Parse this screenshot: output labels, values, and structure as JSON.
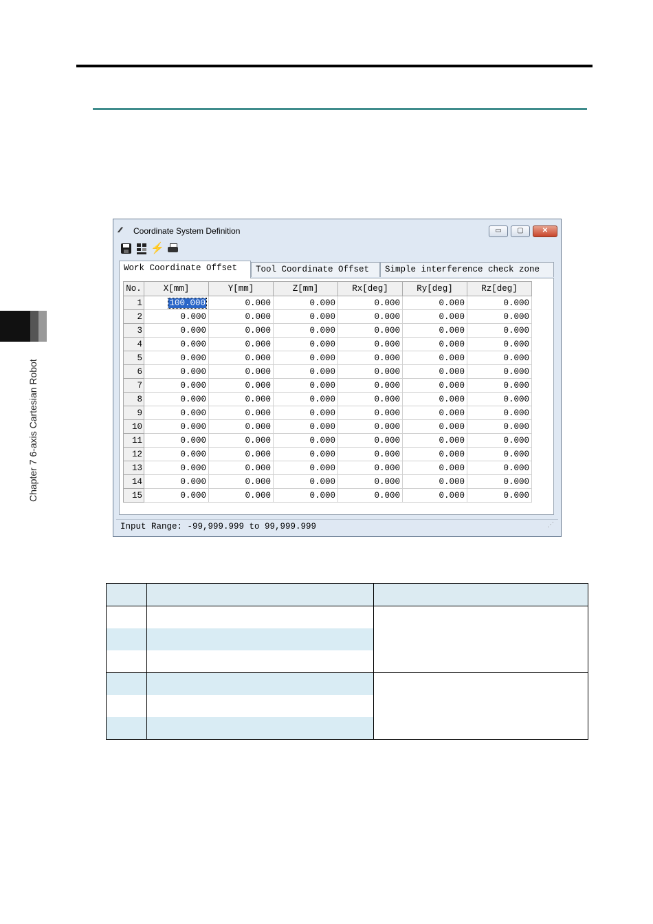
{
  "page": {
    "chapter_label": "Chapter 7 6-axis Cartesian Robot"
  },
  "window": {
    "title": "Coordinate System Definition",
    "app_icon_glyph": "⁄⁄⁄",
    "controls": {
      "minimize": "▭",
      "maximize": "▢",
      "close": "✕"
    }
  },
  "toolbar": {
    "icons": [
      "save-icon",
      "grid-export-icon",
      "lightning-icon",
      "print-icon"
    ]
  },
  "tabs": [
    {
      "label": "Work Coordinate Offset",
      "active": true
    },
    {
      "label": "Tool Coordinate Offset",
      "active": false
    },
    {
      "label": "Simple interference check zone",
      "active": false
    }
  ],
  "grid": {
    "headers": [
      "No.",
      "X[mm]",
      "Y[mm]",
      "Z[mm]",
      "Rx[deg]",
      "Ry[deg]",
      "Rz[deg]"
    ],
    "rows": [
      {
        "no": "1",
        "values": [
          "100.000",
          "0.000",
          "0.000",
          "0.000",
          "0.000",
          "0.000"
        ]
      },
      {
        "no": "2",
        "values": [
          "0.000",
          "0.000",
          "0.000",
          "0.000",
          "0.000",
          "0.000"
        ]
      },
      {
        "no": "3",
        "values": [
          "0.000",
          "0.000",
          "0.000",
          "0.000",
          "0.000",
          "0.000"
        ]
      },
      {
        "no": "4",
        "values": [
          "0.000",
          "0.000",
          "0.000",
          "0.000",
          "0.000",
          "0.000"
        ]
      },
      {
        "no": "5",
        "values": [
          "0.000",
          "0.000",
          "0.000",
          "0.000",
          "0.000",
          "0.000"
        ]
      },
      {
        "no": "6",
        "values": [
          "0.000",
          "0.000",
          "0.000",
          "0.000",
          "0.000",
          "0.000"
        ]
      },
      {
        "no": "7",
        "values": [
          "0.000",
          "0.000",
          "0.000",
          "0.000",
          "0.000",
          "0.000"
        ]
      },
      {
        "no": "8",
        "values": [
          "0.000",
          "0.000",
          "0.000",
          "0.000",
          "0.000",
          "0.000"
        ]
      },
      {
        "no": "9",
        "values": [
          "0.000",
          "0.000",
          "0.000",
          "0.000",
          "0.000",
          "0.000"
        ]
      },
      {
        "no": "10",
        "values": [
          "0.000",
          "0.000",
          "0.000",
          "0.000",
          "0.000",
          "0.000"
        ]
      },
      {
        "no": "11",
        "values": [
          "0.000",
          "0.000",
          "0.000",
          "0.000",
          "0.000",
          "0.000"
        ]
      },
      {
        "no": "12",
        "values": [
          "0.000",
          "0.000",
          "0.000",
          "0.000",
          "0.000",
          "0.000"
        ]
      },
      {
        "no": "13",
        "values": [
          "0.000",
          "0.000",
          "0.000",
          "0.000",
          "0.000",
          "0.000"
        ]
      },
      {
        "no": "14",
        "values": [
          "0.000",
          "0.000",
          "0.000",
          "0.000",
          "0.000",
          "0.000"
        ]
      },
      {
        "no": "15",
        "values": [
          "0.000",
          "0.000",
          "0.000",
          "0.000",
          "0.000",
          "0.000"
        ]
      }
    ],
    "selected_cell": {
      "row": 1,
      "column": "X[mm]"
    }
  },
  "statusbar": {
    "text": "Input Range: -99,999.999 to 99,999.999",
    "grip": "⋰"
  },
  "colors": {
    "section_rule": "#3f8c8c",
    "selection": "#2a66c8",
    "table_shade": "#d9ecf4"
  }
}
